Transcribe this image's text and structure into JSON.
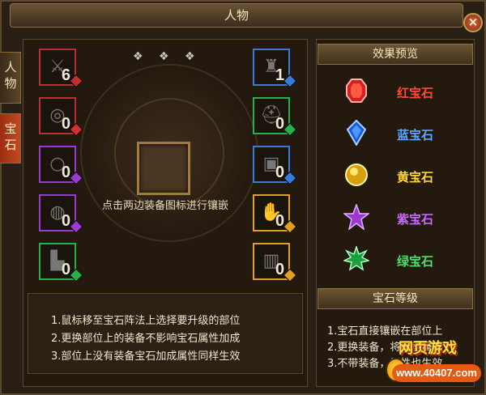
{
  "window": {
    "title": "人物",
    "close_label": "×"
  },
  "side_tabs": [
    {
      "label": "人物",
      "active": false
    },
    {
      "label": "宝石",
      "active": true
    }
  ],
  "top_gem_indicators": [
    "silver-gem",
    "silver-gem",
    "silver-gem"
  ],
  "left_slots": [
    {
      "gear": "weapon",
      "gem_color": "#c03030",
      "level": "6"
    },
    {
      "gear": "necklace",
      "gem_color": "#d03030",
      "level": "0"
    },
    {
      "gear": "ring",
      "gem_color": "#9a3ad0",
      "level": "0"
    },
    {
      "gear": "bracelet",
      "gem_color": "#9a3ad0",
      "level": "0"
    },
    {
      "gear": "boots",
      "gem_color": "#2ab04a",
      "level": "0"
    }
  ],
  "left_slot_borders": [
    "#b83030",
    "#b83030",
    "#9a3ad0",
    "#9a3ad0",
    "#2ab04a"
  ],
  "right_slots": [
    {
      "gear": "armor",
      "gem_color": "#3a7ad8",
      "level": "1"
    },
    {
      "gear": "helmet",
      "gem_color": "#2ab04a",
      "level": "0"
    },
    {
      "gear": "belt",
      "gem_color": "#3a7ad8",
      "level": "0"
    },
    {
      "gear": "gloves",
      "gem_color": "#e0a020",
      "level": "0"
    },
    {
      "gear": "pants",
      "gem_color": "#e0a020",
      "level": "0"
    }
  ],
  "right_slot_borders": [
    "#3a7ad8",
    "#2ab04a",
    "#3a7ad8",
    "#e0a020",
    "#e0a020"
  ],
  "center": {
    "prompt": "点击两边装备图标进行镶嵌"
  },
  "help_lines": [
    "1.鼠标移至宝石阵法上选择要升级的部位",
    "2.更换部位上的装备不影响宝石属性加成",
    "3.部位上没有装备宝石加成属性同样生效"
  ],
  "effect_preview": {
    "title": "效果预览",
    "items": [
      {
        "label": "红宝石",
        "color": "#ff4a3a",
        "icon": "red-gem-icon"
      },
      {
        "label": "蓝宝石",
        "color": "#5aa8ff",
        "icon": "blue-gem-icon"
      },
      {
        "label": "黄宝石",
        "color": "#ffd23a",
        "icon": "yellow-gem-icon"
      },
      {
        "label": "紫宝石",
        "color": "#c46aff",
        "icon": "purple-gem-icon"
      },
      {
        "label": "绿宝石",
        "color": "#4ae06a",
        "icon": "green-gem-icon"
      }
    ]
  },
  "gem_level": {
    "title": "宝石等级",
    "lines": [
      "1.宝石直接镶嵌在部位上",
      "2.更换装备，将继承属性",
      "3.不带装备，属性也生效"
    ]
  },
  "logo": {
    "title": "网页游戏",
    "url": "www.40407.com"
  }
}
